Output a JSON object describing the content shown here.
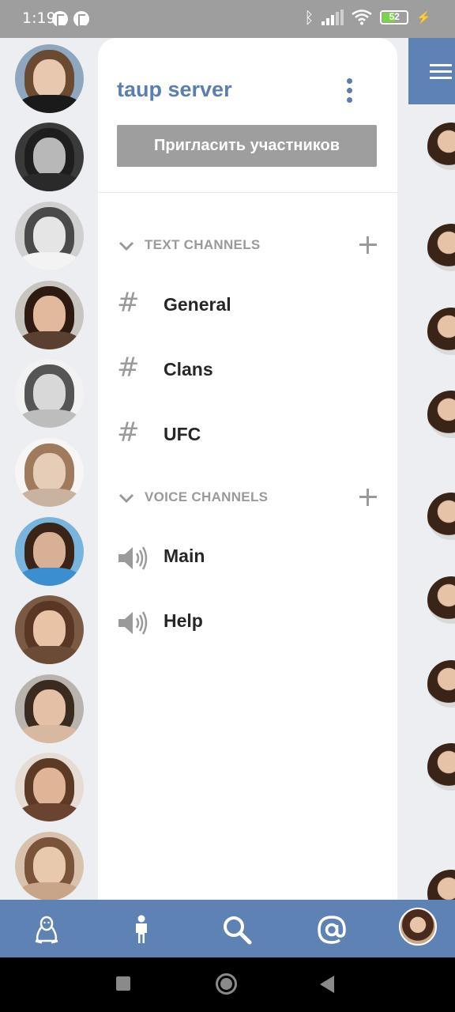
{
  "status_bar": {
    "time": "1:19",
    "battery": "52",
    "app_icons": [
      "pinterest-like-icon",
      "pinterest-like-icon"
    ],
    "icons": [
      "bluetooth-icon",
      "signal-icon",
      "wifi-icon",
      "battery-icon",
      "charging-icon"
    ]
  },
  "server": {
    "name": "taup server",
    "invite_label": "Пригласить участников"
  },
  "categories": [
    {
      "label": "TEXT CHANNELS",
      "channels": [
        {
          "name": "General",
          "icon": "hash-icon"
        },
        {
          "name": "Clans",
          "icon": "hash-icon"
        },
        {
          "name": "UFC",
          "icon": "hash-icon"
        }
      ]
    },
    {
      "label": "VOICE CHANNELS",
      "channels": [
        {
          "name": "Main",
          "icon": "speaker-icon"
        },
        {
          "name": "Help",
          "icon": "speaker-icon"
        }
      ]
    }
  ],
  "bottom_nav": [
    "linux-icon",
    "person-icon",
    "search-icon",
    "at-sign-icon",
    "profile-avatar"
  ],
  "colors": {
    "accent": "#5f82b4",
    "title": "#5b7eb0",
    "muted": "#9a9a9a",
    "button_gray": "#9e9e9e"
  }
}
